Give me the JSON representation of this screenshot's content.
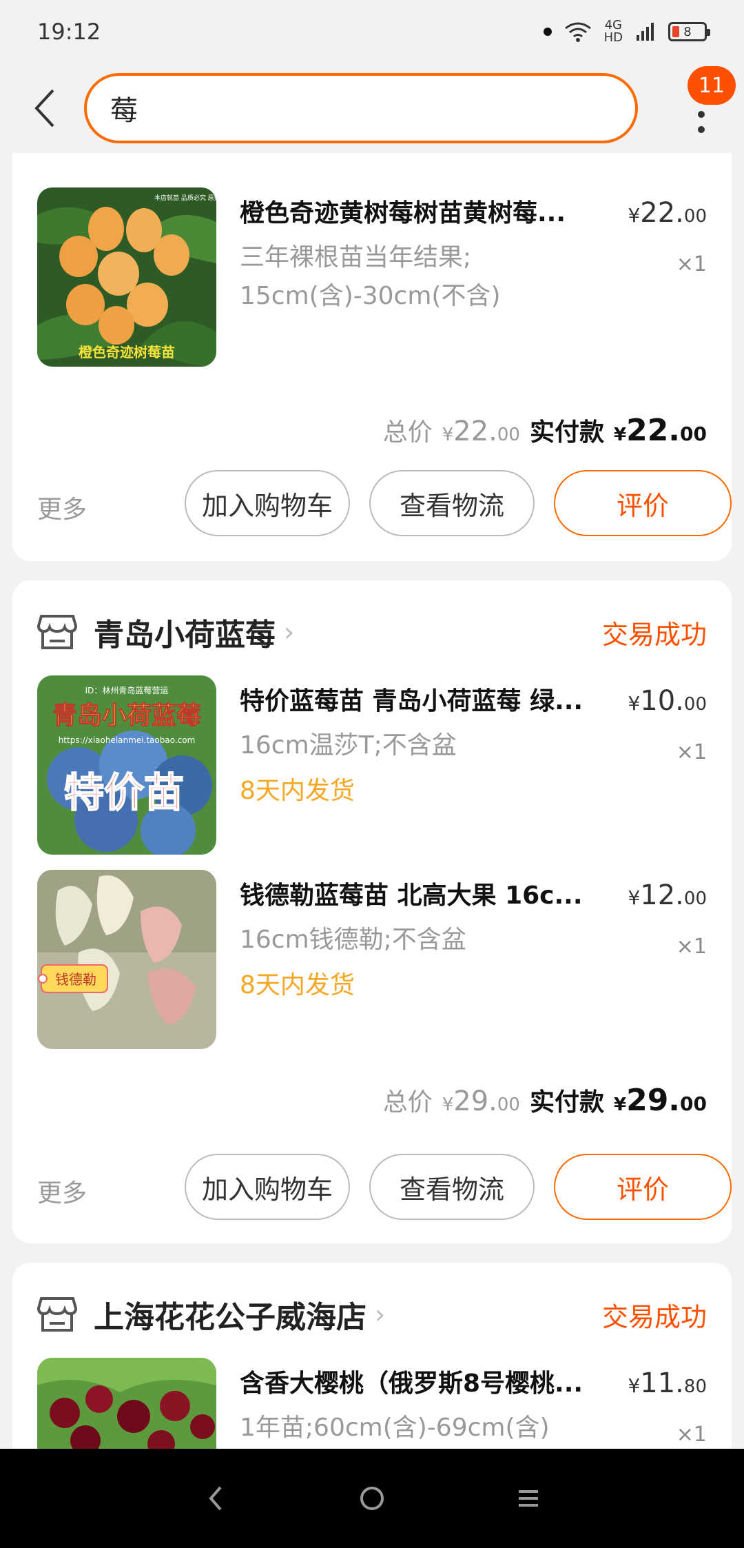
{
  "status_bar": {
    "time": "19:12",
    "net_top": "4G",
    "net_bottom": "HD",
    "battery": "8"
  },
  "search": {
    "query": "莓"
  },
  "menu_badge": "11",
  "orders": [
    {
      "items": [
        {
          "title": "橙色奇迹黄树莓树苗黄树莓...",
          "spec": "三年裸根苗当年结果;\n15cm(含)-30cm(不含)",
          "price_int": "22.",
          "price_dec": "00",
          "qty": "×1"
        }
      ],
      "total_label": "总价",
      "total_int": "22.",
      "total_dec": "00",
      "pay_label": "实付款",
      "pay_int": "22.",
      "pay_dec": "00",
      "actions": {
        "more": "更多",
        "cart": "加入购物车",
        "logistics": "查看物流",
        "review": "评价"
      }
    },
    {
      "shop": "青岛小荷蓝莓",
      "status": "交易成功",
      "items": [
        {
          "title": "特价蓝莓苗 青岛小荷蓝莓 绿...",
          "spec": "16cm温莎T;不含盆",
          "ship": "8天内发货",
          "price_int": "10.",
          "price_dec": "00",
          "qty": "×1"
        },
        {
          "title": "钱德勒蓝莓苗 北高大果 16c...",
          "spec": "16cm钱德勒;不含盆",
          "ship": "8天内发货",
          "price_int": "12.",
          "price_dec": "00",
          "qty": "×1"
        }
      ],
      "total_label": "总价",
      "total_int": "29.",
      "total_dec": "00",
      "pay_label": "实付款",
      "pay_int": "29.",
      "pay_dec": "00",
      "actions": {
        "more": "更多",
        "cart": "加入购物车",
        "logistics": "查看物流",
        "review": "评价"
      }
    },
    {
      "shop": "上海花花公子威海店",
      "status": "交易成功",
      "items": [
        {
          "title": "含香大樱桃（俄罗斯8号樱桃...",
          "spec": "1年苗;60cm(含)-69cm(含)",
          "price_int": "11.",
          "price_dec": "80",
          "qty": "×1"
        }
      ]
    }
  ],
  "currency": "¥",
  "images": {
    "item1": {
      "caption": "橙色奇迹树莓苗",
      "tag": "本店就苗 品质必究 原始实苗"
    },
    "item2": {
      "caption_top": "青岛小荷蓝莓",
      "caption_main": "特价苗",
      "url": "https://xiaohelanmei.taobao.com",
      "banner": "ID：林州青岛蓝莓营运"
    },
    "item3": {
      "tag": "钱德勒"
    }
  },
  "colors": {
    "accent": "#ff5000",
    "ship": "#f5a623"
  }
}
